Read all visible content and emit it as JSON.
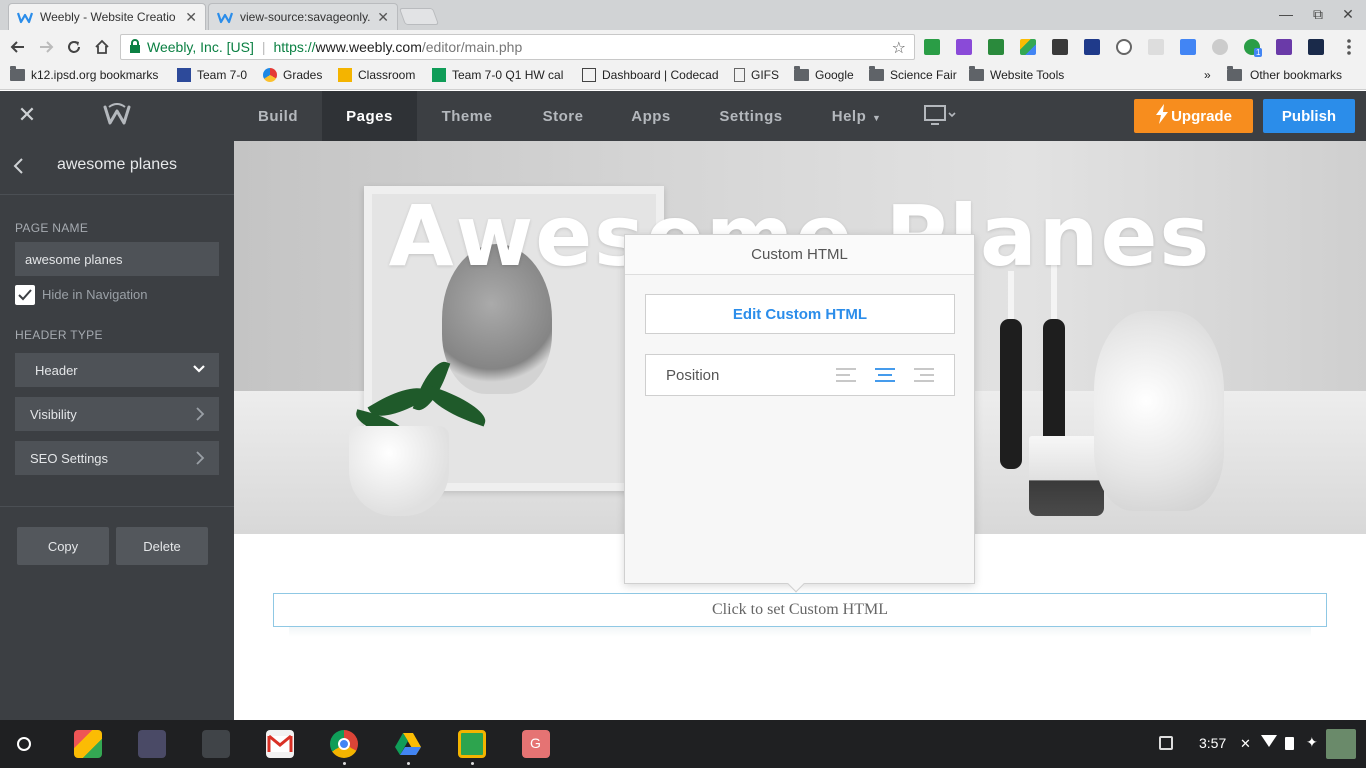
{
  "browser": {
    "tabs": [
      {
        "title": "Weebly - Website Creatio",
        "active": true
      },
      {
        "title": "view-source:savageonly.",
        "active": false
      }
    ],
    "omnibox": {
      "org": "Weebly, Inc. [US]",
      "protocol": "https://",
      "host": "www.weebly.com",
      "path": "/editor/main.php"
    },
    "bookmarks": [
      "k12.ipsd.org bookmarks",
      "Team 7-0",
      "Grades",
      "Classroom",
      "Team 7-0 Q1 HW cal",
      "Dashboard | Codecad",
      "GIFS",
      "Google",
      "Science Fair",
      "Website Tools"
    ],
    "bookmarks_more": "»",
    "other_bookmarks": "Other bookmarks",
    "extension_badge": "1"
  },
  "editor": {
    "nav": [
      "Build",
      "Pages",
      "Theme",
      "Store",
      "Apps",
      "Settings",
      "Help"
    ],
    "active_nav": "Pages",
    "upgrade_label": "Upgrade",
    "publish_label": "Publish"
  },
  "sidebar": {
    "title": "awesome planes",
    "page_name_label": "PAGE NAME",
    "page_name_value": "awesome planes",
    "hide_nav_label": "Hide in Navigation",
    "hide_nav_checked": true,
    "header_type_label": "HEADER TYPE",
    "header_type_value": "Header",
    "visibility_label": "Visibility",
    "seo_label": "SEO Settings",
    "copy_label": "Copy",
    "delete_label": "Delete"
  },
  "canvas": {
    "hero_title": "Awesome Planes",
    "custom_html_placeholder": "Click to set Custom HTML"
  },
  "popover": {
    "title": "Custom HTML",
    "edit_label": "Edit Custom HTML",
    "position_label": "Position",
    "position_selected": "center"
  },
  "shelf": {
    "time": "3:57"
  },
  "colors": {
    "accent_blue": "#2b8dea",
    "upgrade_orange": "#f78d1e",
    "editor_dark": "#3c3f43"
  }
}
